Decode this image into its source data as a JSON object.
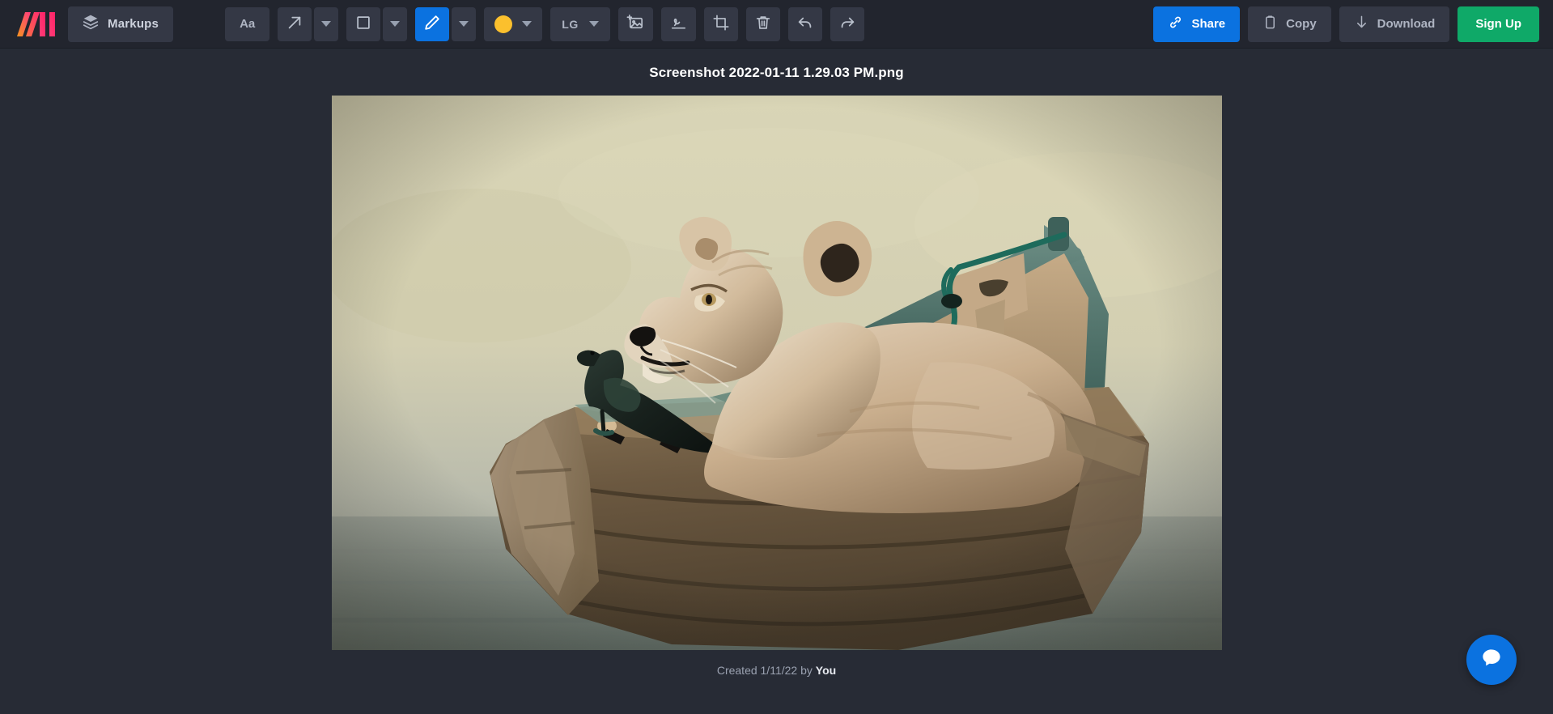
{
  "brand": {
    "logo_name": "markup-hero-logo"
  },
  "toolbar": {
    "markups_label": "Markups",
    "text_tool_label": "Aa",
    "arrow_tool_name": "arrow-icon",
    "arrow_caret_name": "chevron-down-icon",
    "rect_tool_name": "square-icon",
    "rect_caret_name": "chevron-down-icon",
    "pen_tool_name": "pencil-icon",
    "pen_caret_name": "chevron-down-icon",
    "color_swatch_name": "color-swatch",
    "color_value": "#FBC02D",
    "color_caret_name": "chevron-down-icon",
    "size_label": "LG",
    "size_caret_name": "chevron-down-icon",
    "add_image_name": "add-image-icon",
    "signature_name": "signature-icon",
    "crop_name": "crop-icon",
    "delete_name": "trash-icon",
    "undo_name": "undo-icon",
    "redo_name": "redo-icon",
    "active_tool": "pen",
    "active_color": "#0B72E0"
  },
  "actions": {
    "share_label": "Share",
    "share_icon": "link-icon",
    "copy_label": "Copy",
    "copy_icon": "clipboard-icon",
    "download_label": "Download",
    "download_icon": "download-arrow-icon",
    "signup_label": "Sign Up",
    "signup_color": "#0FA968"
  },
  "document": {
    "title": "Screenshot 2022-01-11 1.29.03 PM.png",
    "created_prefix": "Created 1/11/22 by ",
    "created_author": "You"
  },
  "chat": {
    "icon_name": "chat-bubble-icon"
  }
}
